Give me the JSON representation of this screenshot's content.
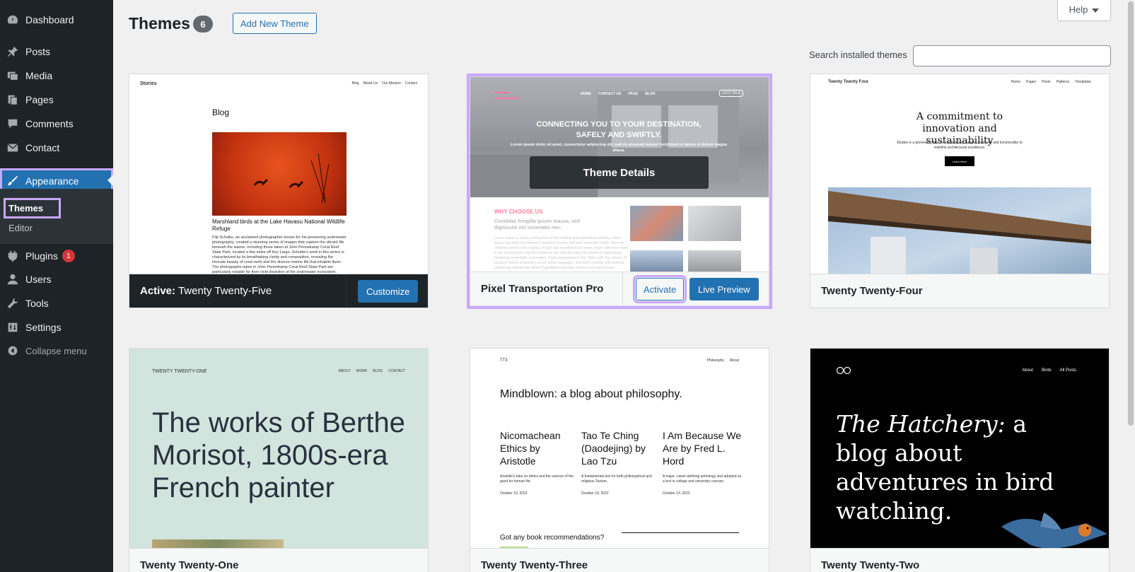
{
  "sidebar": {
    "items": [
      {
        "label": "Dashboard",
        "icon": "dashboard-icon"
      },
      {
        "label": "Posts",
        "icon": "pin-icon"
      },
      {
        "label": "Media",
        "icon": "media-icon"
      },
      {
        "label": "Pages",
        "icon": "pages-icon"
      },
      {
        "label": "Comments",
        "icon": "comment-icon"
      },
      {
        "label": "Contact",
        "icon": "mail-icon"
      },
      {
        "label": "Appearance",
        "icon": "paintbrush-icon"
      },
      {
        "label": "Plugins",
        "icon": "plugin-icon",
        "badge": "1"
      },
      {
        "label": "Users",
        "icon": "users-icon"
      },
      {
        "label": "Tools",
        "icon": "wrench-icon"
      },
      {
        "label": "Settings",
        "icon": "settings-icon"
      }
    ],
    "submenu": [
      "Themes",
      "Editor"
    ],
    "collapse_label": "Collapse menu"
  },
  "header": {
    "title": "Themes",
    "count": "6",
    "add_new_label": "Add New Theme",
    "help_label": "Help"
  },
  "search": {
    "label": "Search installed themes",
    "value": ""
  },
  "themes": [
    {
      "name": "Twenty Twenty-Five",
      "active_prefix": "Active:",
      "action": "Customize",
      "preview": {
        "site": "Stories",
        "nav": [
          "Blog",
          "About Us",
          "Our Mission",
          "Contact"
        ],
        "heading": "Blog",
        "caption": "Marshland birds at the Lake Havasu National Wildlife Refuge",
        "body": "Flip Schulke, an acclaimed photographer known for his pioneering underwater photography, created a stunning series of images that capture the vibrant life beneath the waves, including those taken at John Pennekamp Coral Reef State Park, located a few miles off Key Largo. Schulke's work in this series is characterized by its breathtaking clarity and composition, revealing the intricate beauty of coral reefs and the diverse marine life that inhabits them. The photographs taken in John Pennekamp Coral Reef State Park are particularly notable for their vivid depiction of the underwater ecosystem."
      }
    },
    {
      "name": "Pixel Transportation Pro",
      "overlay": "Theme Details",
      "activate_label": "Activate",
      "preview_label": "Live Preview",
      "preview": {
        "nav": [
          "HOME",
          "CONTACT US",
          "PAGE",
          "BLOG"
        ],
        "cta": "LETS TALK",
        "hero": "CONNECTING YOU TO YOUR DESTINATION, SAFELY AND SWIFTLY.",
        "hero_sub": "Lorem ipsum dolor sit amet, consectetur adipiscing elit, sed do eiusmod tempor incididunt ut labore et dolore magna aliqua.",
        "why": "WHY CHOOSE US",
        "why_heading": "Curabitur fringilla ipsum massa, sed dignissim est venenatis nec.",
        "why_body": "Lorem Ipsum is simply dummy text of the printing and typesetting industry. Lorem Ipsum has been the industry's standard dummy text ever since the 1500s, when an unknown printer took a galley of type and scrambled it to make a type specimen book. It has survived not only five centuries, but also the leap into electronic typesetting, remaining essentially unchanged. It was popularised in the 1960s with the release of Letraset sheets containing Lorem Ipsum passages, and more recently with desktop publishing software like Aldus PageMaker including versions of Lorem Ipsum."
      }
    },
    {
      "name": "Twenty Twenty-Four",
      "preview": {
        "site": "Twenty Twenty Four",
        "nav": [
          "Home",
          "Pages",
          "Posts",
          "Patterns",
          "Templates"
        ],
        "heading": "A commitment to innovation and sustainability",
        "sub": "Études is a pioneering firm that seamlessly merges creativity and functionality to redefine architectural excellence.",
        "button": "Learn More"
      }
    },
    {
      "name": "Twenty Twenty-One",
      "preview": {
        "site": "TWENTY TWENTY-ONE",
        "nav": [
          "ABOUT",
          "WORK",
          "BLOG",
          "CONTACT"
        ],
        "heading": "The works of Berthe Morisot, 1800s-era French painter"
      }
    },
    {
      "name": "Twenty Twenty-Three",
      "preview": {
        "site": "TT3",
        "nav": [
          "Philosophy",
          "About"
        ],
        "heading": "Mindblown: a blog about philosophy.",
        "posts": [
          {
            "title": "Nicomachean Ethics by Aristotle",
            "excerpt": "Aristotle's take on ethics and the science of the good for human life.",
            "date": "October 19, 2022"
          },
          {
            "title": "Tao Te Ching (Daodejing) by Lao Tzu",
            "excerpt": "A fundamental text for both philosophical and religious Taoism.",
            "date": "October 19, 2022"
          },
          {
            "title": "I Am Because We Are by Fred L. Hord",
            "excerpt": "A major, canon-defining anthology and adopted as a text in college and university courses.",
            "date": "October 19, 2022"
          }
        ],
        "footer_question": "Got any book recommendations?"
      }
    },
    {
      "name": "Twenty Twenty-Two",
      "preview": {
        "nav": [
          "About",
          "Birds",
          "All Posts"
        ],
        "heading_italic": "The Hatchery:",
        "heading_rest": "a blog about adventures in bird watching."
      }
    }
  ],
  "colors": {
    "sidebar_bg": "#1d2327",
    "accent": "#2271b1",
    "highlight": "#c9a8ff",
    "badge": "#d63638"
  }
}
